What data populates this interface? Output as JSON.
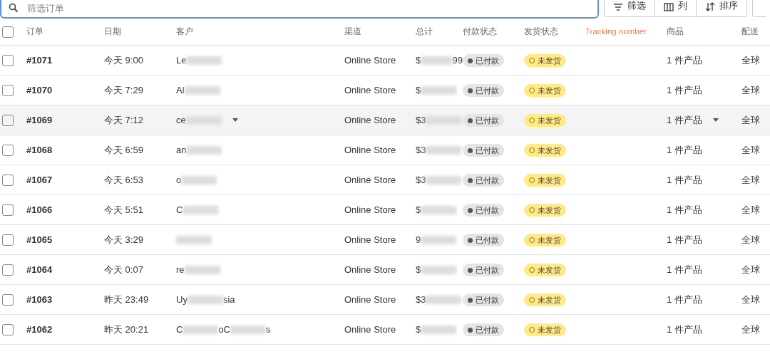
{
  "toolbar": {
    "search": {
      "placeholder": "筛选订单"
    },
    "buttons": [
      {
        "label": "筛选",
        "kind": "filter"
      },
      {
        "label": "列",
        "kind": "columns"
      },
      {
        "label": "排序",
        "kind": "sort"
      }
    ]
  },
  "table": {
    "select_all": {
      "checked": false
    },
    "columns": [
      {
        "label": "订单",
        "kind": "plain"
      },
      {
        "label": "日期",
        "kind": "plain"
      },
      {
        "label": "客户",
        "kind": "plain"
      },
      {
        "label": "渠道",
        "kind": "plain"
      },
      {
        "label": "总计",
        "kind": "plain"
      },
      {
        "label": "付款状态",
        "kind": "plain"
      },
      {
        "label": "发货状态",
        "kind": "plain"
      },
      {
        "label": "Tracking number",
        "kind": "custom"
      },
      {
        "label": "商品",
        "kind": "plain"
      },
      {
        "label": "配送",
        "kind": "plain"
      }
    ],
    "rows": [
      {
        "checked": false,
        "hovered": false,
        "order": "#1071",
        "date": "今天 9:00",
        "customer": [
          "Le"
        ],
        "channel": "Online Store",
        "total": [
          "$",
          "99"
        ],
        "payment": "已付款",
        "fulfillment": "未发货",
        "items": "1 件产品",
        "shipping": "全球"
      },
      {
        "checked": false,
        "hovered": false,
        "order": "#1070",
        "date": "今天 7:29",
        "customer": [
          "Al"
        ],
        "channel": "Online Store",
        "total": [
          "$"
        ],
        "payment": "已付款",
        "fulfillment": "未发货",
        "items": "1 件产品",
        "shipping": "全球"
      },
      {
        "checked": false,
        "hovered": true,
        "order": "#1069",
        "date": "今天 7:12",
        "customer": [
          "ce"
        ],
        "channel": "Online Store",
        "total": [
          "$3"
        ],
        "payment": "已付款",
        "fulfillment": "未发货",
        "items": "1 件产品",
        "shipping": "全球"
      },
      {
        "checked": false,
        "hovered": false,
        "order": "#1068",
        "date": "今天 6:59",
        "customer": [
          "an"
        ],
        "channel": "Online Store",
        "total": [
          "$3"
        ],
        "payment": "已付款",
        "fulfillment": "未发货",
        "items": "1 件产品",
        "shipping": "全球"
      },
      {
        "checked": false,
        "hovered": false,
        "order": "#1067",
        "date": "今天 6:53",
        "customer": [
          "o"
        ],
        "channel": "Online Store",
        "total": [
          "$3"
        ],
        "payment": "已付款",
        "fulfillment": "未发货",
        "items": "1 件产品",
        "shipping": "全球"
      },
      {
        "checked": false,
        "hovered": false,
        "order": "#1066",
        "date": "今天 5:51",
        "customer": [
          "C"
        ],
        "channel": "Online Store",
        "total": [
          "$"
        ],
        "payment": "已付款",
        "fulfillment": "未发货",
        "items": "1 件产品",
        "shipping": "全球"
      },
      {
        "checked": false,
        "hovered": false,
        "order": "#1065",
        "date": "今天 3:29",
        "customer": [],
        "channel": "Online Store",
        "total": [
          "9"
        ],
        "payment": "已付款",
        "fulfillment": "未发货",
        "items": "1 件产品",
        "shipping": "全球"
      },
      {
        "checked": false,
        "hovered": false,
        "order": "#1064",
        "date": "今天 0:07",
        "customer": [
          "re"
        ],
        "channel": "Online Store",
        "total": [
          "$"
        ],
        "payment": "已付款",
        "fulfillment": "未发货",
        "items": "1 件产品",
        "shipping": "全球"
      },
      {
        "checked": false,
        "hovered": false,
        "order": "#1063",
        "date": "昨天 23:49",
        "customer": [
          "Uy",
          "sia"
        ],
        "channel": "Online Store",
        "total": [
          "$3"
        ],
        "payment": "已付款",
        "fulfillment": "未发货",
        "items": "1 件产品",
        "shipping": "全球"
      },
      {
        "checked": false,
        "hovered": false,
        "order": "#1062",
        "date": "昨天 20:21",
        "customer": [
          "C",
          "oC",
          "s"
        ],
        "channel": "Online Store",
        "total": [
          "$"
        ],
        "payment": "已付款",
        "fulfillment": "未发货",
        "items": "1 件产品",
        "shipping": "全球"
      }
    ]
  }
}
